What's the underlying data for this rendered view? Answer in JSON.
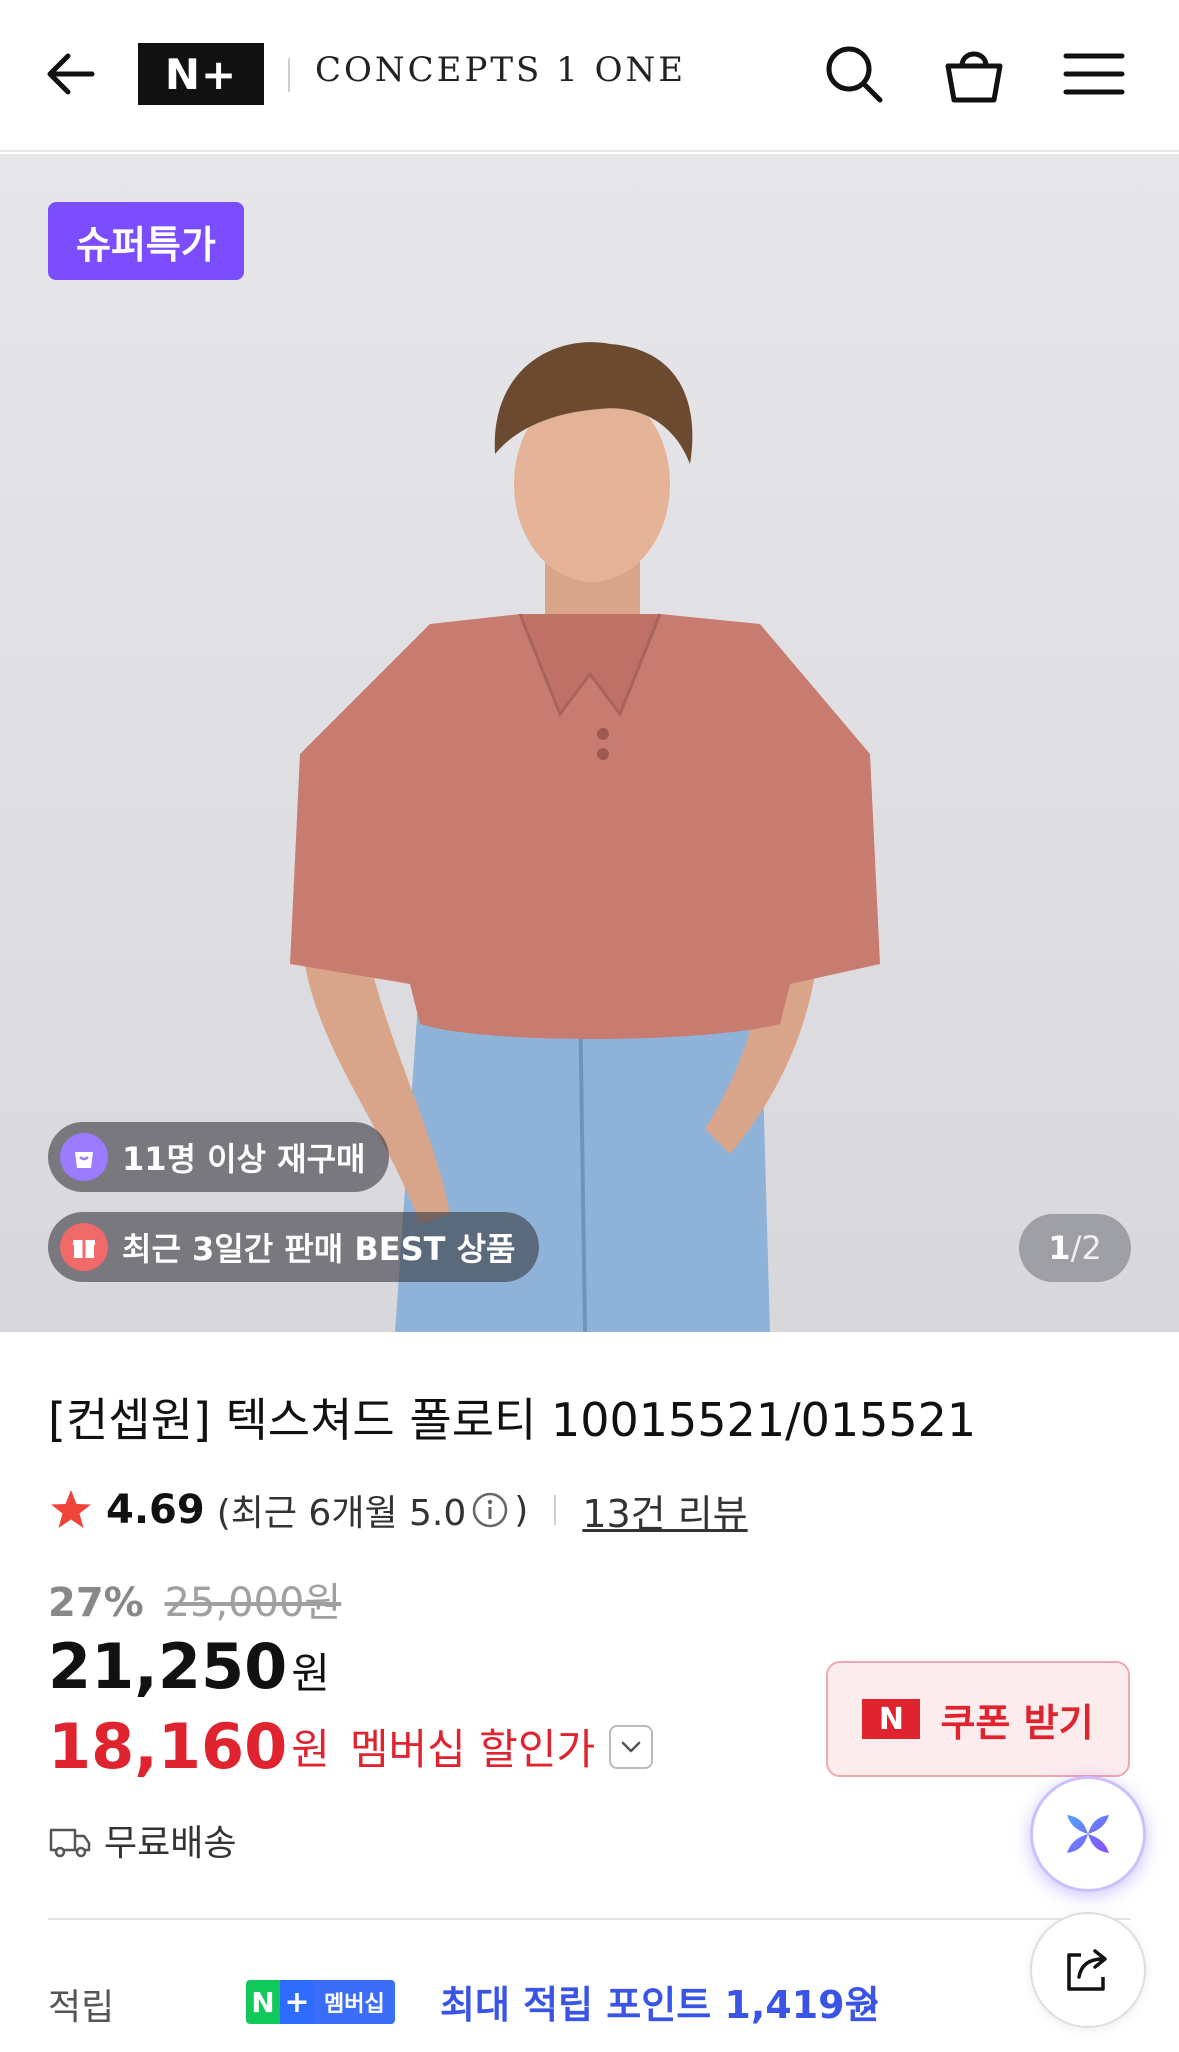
{
  "header": {
    "logo_text": "N+",
    "brand_name": "CONCEPTS 1 ONE",
    "icons": [
      "back-arrow-icon",
      "search-icon",
      "shopping-bag-icon",
      "hamburger-menu-icon"
    ]
  },
  "hero": {
    "badge_label": "슈퍼특가",
    "repurchase_label": "11명 이상 재구매",
    "best_label": "최근 3일간 판매 BEST 상품",
    "pager_current": "1",
    "pager_separator": "/",
    "pager_total": "2"
  },
  "product": {
    "title": "[컨셉원] 텍스쳐드 폴로티 10015521/015521",
    "rating": "4.69",
    "recent_rating": "(최근 6개월 5.0",
    "recent_rating_close": ")",
    "review_count_label": "13건 리뷰",
    "discount_rate": "27%",
    "original_price": "25,000원",
    "price": "21,250",
    "price_unit": "원",
    "member_price": "18,160",
    "member_price_unit": "원",
    "member_price_label": "멤버십 할인가",
    "coupon_icon_text": "N",
    "coupon_label": "쿠폰 받기",
    "shipping_label": "무료배송",
    "points_label": "적립",
    "membership_chip_n": "N",
    "membership_chip_plus": "+",
    "membership_chip_text": "멤버십",
    "points_text": "최대 적립 포인트 1,419원"
  },
  "colors": {
    "accent_purple": "#7c4dff",
    "sale_red": "#e0242f",
    "points_blue": "#3a55e6",
    "membership_green": "#11c95a"
  }
}
